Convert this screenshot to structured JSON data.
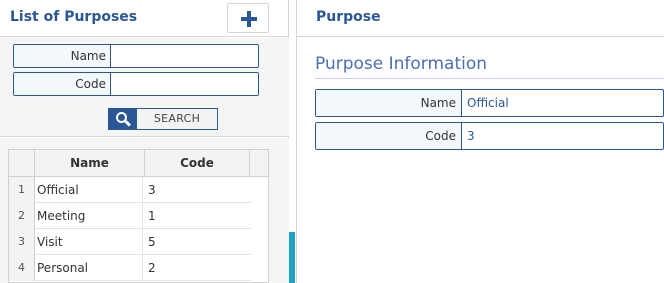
{
  "left": {
    "title": "List of Purposes",
    "add_icon": "plus-icon",
    "filters": {
      "name_label": "Name",
      "name_value": "",
      "code_label": "Code",
      "code_value": ""
    },
    "search": {
      "icon": "search-icon",
      "label": "SEARCH"
    },
    "grid": {
      "columns": [
        "Name",
        "Code"
      ],
      "rows": [
        {
          "num": "1",
          "name": "Official",
          "code": "3"
        },
        {
          "num": "2",
          "name": "Meeting",
          "code": "1"
        },
        {
          "num": "3",
          "name": "Visit",
          "code": "5"
        },
        {
          "num": "4",
          "name": "Personal",
          "code": "2"
        }
      ]
    }
  },
  "right": {
    "title": "Purpose",
    "section_title": "Purpose Information",
    "fields": {
      "name_label": "Name",
      "name_value": "Official",
      "code_label": "Code",
      "code_value": "3"
    }
  },
  "colors": {
    "accent": "#2b5797",
    "section_title": "#4a6fb0",
    "scroll_indicator": "#1fa3c7",
    "label_bg": "#f3f8fd"
  }
}
